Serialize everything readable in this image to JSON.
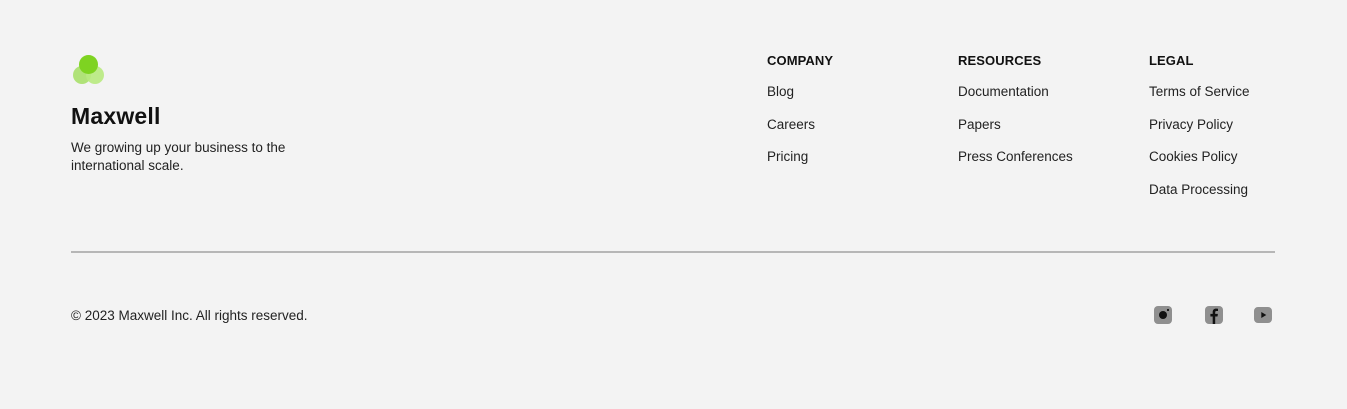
{
  "brand": {
    "name": "Maxwell",
    "tagline": "We growing up your business to the international scale.",
    "logo_colors": [
      "#7ed321",
      "#a8e06a",
      "#b8ea80"
    ]
  },
  "columns": {
    "company": {
      "heading": "COMPANY",
      "links": [
        "Blog",
        "Careers",
        "Pricing"
      ]
    },
    "resources": {
      "heading": "RESOURCES",
      "links": [
        "Documentation",
        "Papers",
        "Press Conferences"
      ]
    },
    "legal": {
      "heading": "LEGAL",
      "links": [
        "Terms of Service",
        "Privacy Policy",
        "Cookies Policy",
        "Data Processing"
      ]
    }
  },
  "copyright": "© 2023 Maxwell Inc. All rights reserved.",
  "socials": [
    "instagram-icon",
    "facebook-icon",
    "youtube-icon"
  ],
  "colors": {
    "accent": "#7ed321",
    "background": "#f3f3f3",
    "divider": "#b6b6b6",
    "icon": "#8f8f8f"
  }
}
